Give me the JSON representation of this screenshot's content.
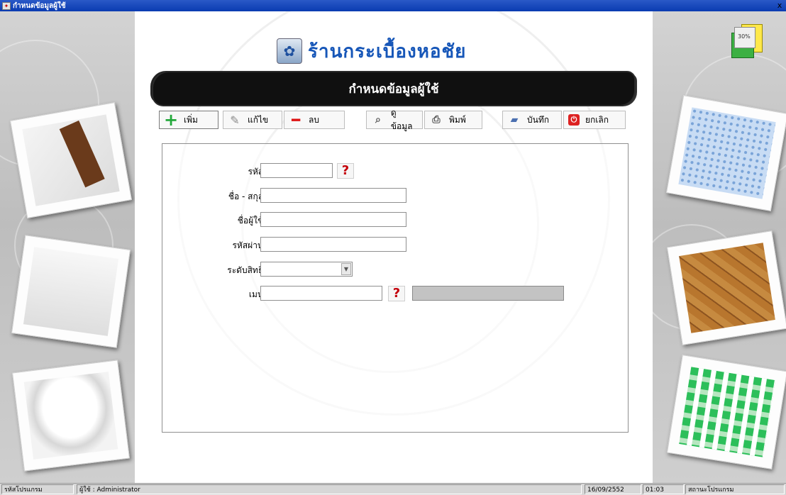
{
  "window": {
    "title": "กำหนดข้อมูลผู้ใช้",
    "close_label": "x"
  },
  "brand": {
    "name": "ร้านกระเบื้องหอชัย"
  },
  "banner": {
    "title": "กำหนดข้อมูลผู้ใช้"
  },
  "toolbar": {
    "add_label": "เพิ่ม",
    "edit_label": "แก้ไข",
    "delete_label": "ลบ",
    "view_label": "ดูข้อมูล",
    "print_label": "พิมพ์",
    "save_label": "บันทึก",
    "cancel_label": "ยกเลิก"
  },
  "form": {
    "code_label": "รหัส :",
    "code_value": "",
    "fullname_label": "ชื่อ - สกุล :",
    "fullname_value": "",
    "username_label": "ชื่อผู้ใช้ :",
    "username_value": "",
    "password_label": "รหัสผ่าน :",
    "password_value": "",
    "level_label": "ระดับสิทธิ :",
    "level_value": "",
    "menu_label": "เมนู :",
    "menu_value": "",
    "help_glyph": "?"
  },
  "statusbar": {
    "program_code": "รหัสโปรแกรม",
    "user": "ผู้ใช้ : Administrator",
    "date": "16/09/2552",
    "time": "01:03",
    "program_status": "สถานะโปรแกรม"
  },
  "corner_widget": {
    "text": "30%"
  },
  "icons": {
    "app": "app-icon",
    "add": "plus-icon",
    "edit": "pencil-icon",
    "delete": "minus-icon",
    "view": "magnifier-icon",
    "print": "printer-icon",
    "save": "folder-icon",
    "cancel": "power-icon"
  }
}
